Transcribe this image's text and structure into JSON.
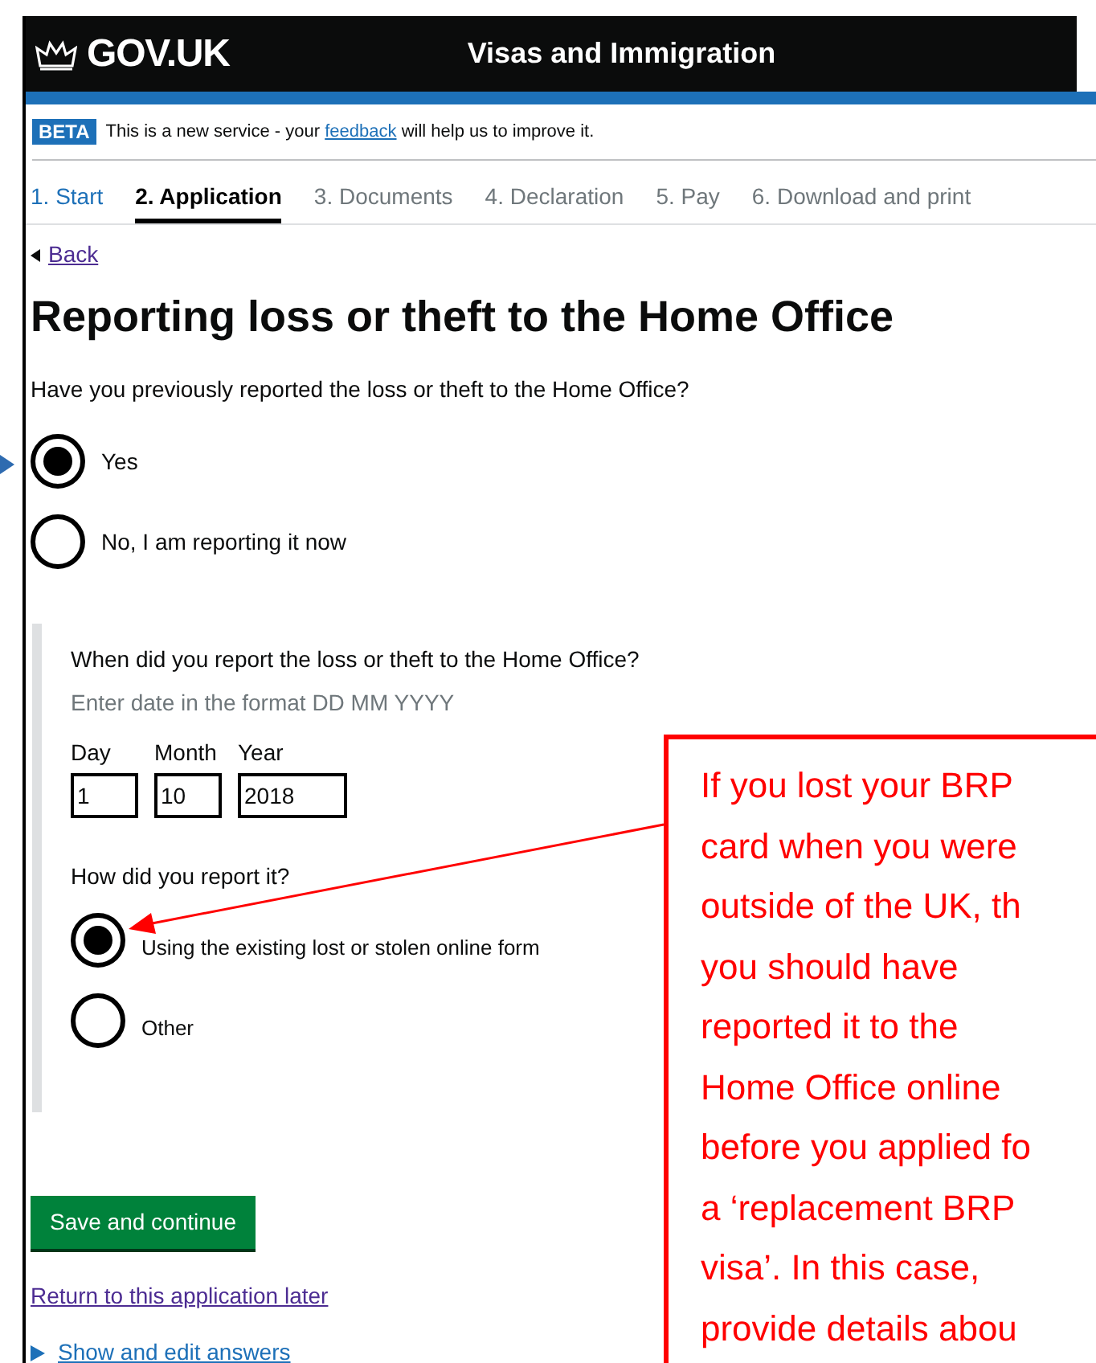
{
  "header": {
    "logo": "GOV.UK",
    "service": "Visas and Immigration"
  },
  "beta_banner": {
    "tag": "BETA",
    "text_before": "This is a new service - your",
    "link": "feedback",
    "text_after": "will help us to improve it."
  },
  "steps": [
    {
      "label": "1. Start",
      "selected": false,
      "done": true
    },
    {
      "label": "2. Application",
      "selected": true,
      "done": false
    },
    {
      "label": "3. Documents",
      "selected": false,
      "done": false
    },
    {
      "label": "4. Declaration",
      "selected": false,
      "done": false
    },
    {
      "label": "5. Pay",
      "selected": false,
      "done": false
    },
    {
      "label": "6. Download and print",
      "selected": false,
      "done": false
    }
  ],
  "back_link": "Back",
  "heading": "Reporting loss or theft to the Home Office",
  "question": "Have you previously reported the loss or theft to the Home Office?",
  "options": [
    {
      "label": "Yes",
      "selected": true
    },
    {
      "label": "No, I am reporting it now",
      "selected": false
    }
  ],
  "date_question": {
    "label": "When did you report the loss or theft to the Home Office?",
    "hint": "Enter date in the format DD MM YYYY",
    "fields": [
      {
        "label": "Day",
        "value": "1"
      },
      {
        "label": "Month",
        "value": "10"
      },
      {
        "label": "Year",
        "value": "2018"
      }
    ]
  },
  "method_question": {
    "label": "How did you report it?",
    "options": [
      {
        "label": "Using the existing lost or stolen online form",
        "selected": true
      },
      {
        "label": "Other",
        "selected": false
      }
    ]
  },
  "save_button": "Save and continue",
  "return_link": "Return to this application later",
  "show_answers_link": "Show and edit answers",
  "callout": {
    "lines": [
      "If you lost your BRP",
      "card when you were",
      "outside of the UK, th",
      "you should have",
      "reported it to the",
      "Home Office online",
      "before you applied fo",
      "a ‘replacement BRP",
      "visa’. In this case,",
      "provide details abou"
    ]
  }
}
